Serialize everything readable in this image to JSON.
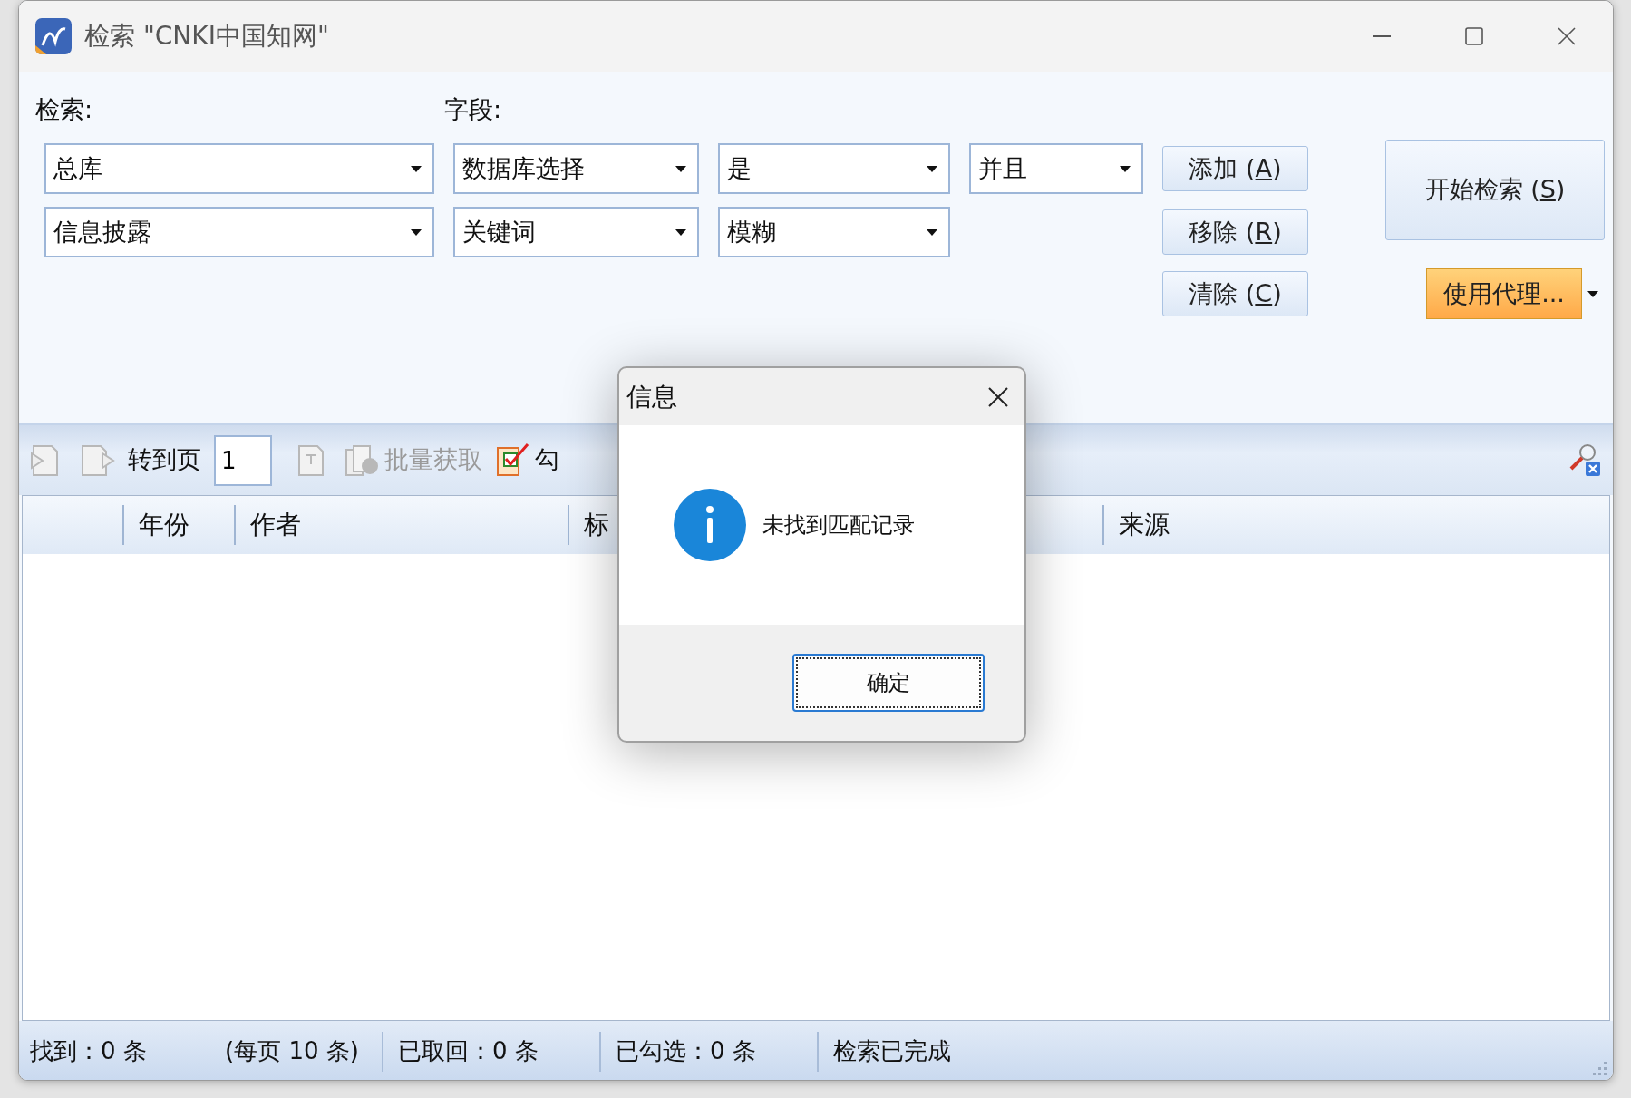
{
  "window": {
    "title": "检索 \"CNKI中国知网\""
  },
  "search_panel": {
    "search_label": "检索:",
    "field_label": "字段:",
    "rows": [
      {
        "database": "总库",
        "field": "数据库选择",
        "value": "是",
        "logic": "并且"
      },
      {
        "database": "信息披露",
        "field": "关键词",
        "value": "模糊"
      }
    ],
    "buttons": [
      {
        "text_before": "添加 (",
        "access_key": "A",
        "text_after": ")"
      },
      {
        "text_before": "移除 (",
        "access_key": "R",
        "text_after": ")"
      },
      {
        "text_before": "清除 (",
        "access_key": "C",
        "text_after": ")"
      }
    ],
    "start_button": {
      "text_before": "开始检索 (",
      "access_key": "S",
      "text_after": ")"
    },
    "proxy_button": {
      "label": "使用代理..."
    }
  },
  "toolbar": {
    "items": [
      {
        "kind": "prev",
        "disabled": true
      },
      {
        "kind": "next",
        "disabled": true
      },
      {
        "kind": "label",
        "text": "转到页"
      },
      {
        "kind": "input",
        "value": "1"
      },
      {
        "kind": "goto",
        "disabled": true
      },
      {
        "kind": "batch",
        "text": "批量获取",
        "disabled": true
      },
      {
        "kind": "check",
        "text": "勾",
        "disabled": false
      }
    ]
  },
  "table": {
    "columns": [
      "年份",
      "作者",
      "标",
      "来源"
    ]
  },
  "status_bar": [
    "找到：0 条",
    "(每页 10 条)",
    "已取回：0 条",
    "已勾选：0 条",
    "检索已完成"
  ],
  "dialog": {
    "title": "信息",
    "message": "未找到匹配记录",
    "ok": "确定"
  }
}
